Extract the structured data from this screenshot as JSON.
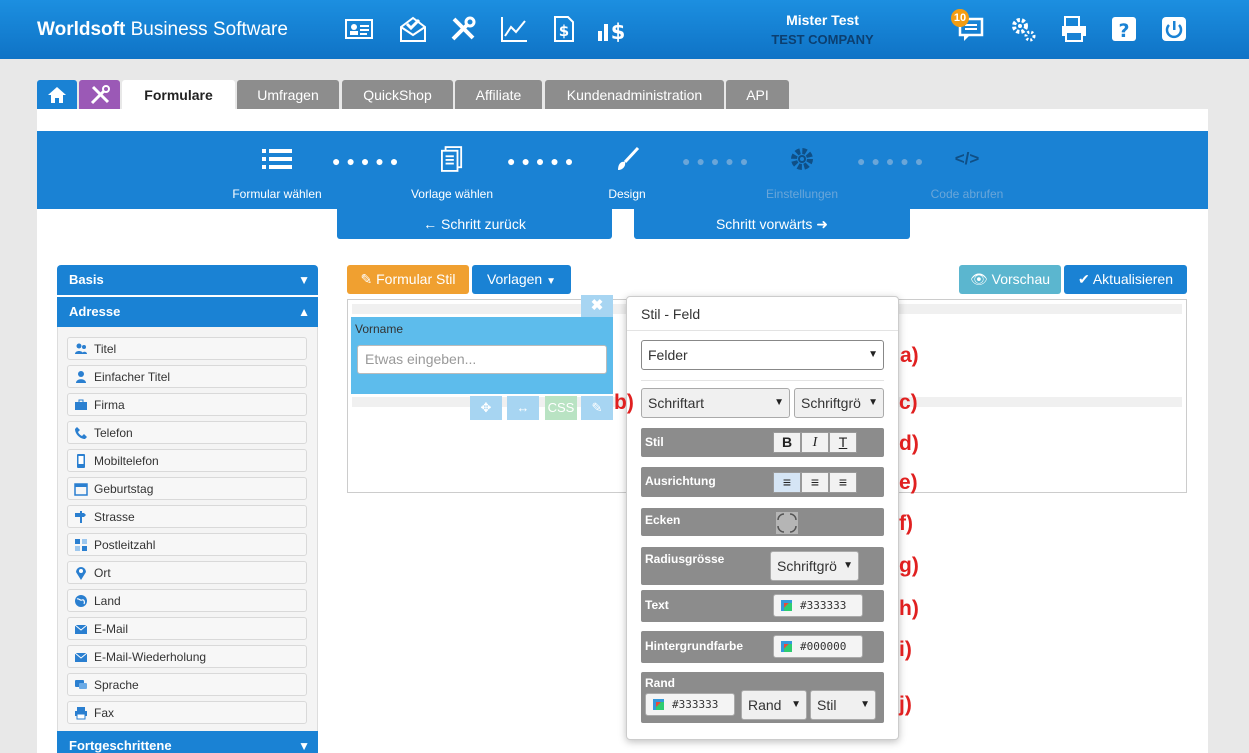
{
  "header": {
    "brand_bold": "Worldsoft",
    "brand_rest": " Business Software",
    "user_name": "Mister Test",
    "company": "TEST COMPANY",
    "notification_count": "10"
  },
  "tabs": [
    {
      "label": "Formulare"
    },
    {
      "label": "Umfragen"
    },
    {
      "label": "QuickShop"
    },
    {
      "label": "Affiliate"
    },
    {
      "label": "Kundenadministration"
    },
    {
      "label": "API"
    }
  ],
  "steps": [
    {
      "label": "Formular wählen"
    },
    {
      "label": "Vorlage wählen"
    },
    {
      "label": "Design"
    },
    {
      "label": "Einstellungen"
    },
    {
      "label": "Code abrufen"
    }
  ],
  "nav": {
    "back": "← Schritt zurück",
    "forward": "Schritt vorwärts ➜"
  },
  "sidebar": {
    "basis": "Basis",
    "adresse": "Adresse",
    "fortgeschrittene": "Fortgeschrittene",
    "items": [
      {
        "label": "Titel"
      },
      {
        "label": "Einfacher Titel"
      },
      {
        "label": "Firma"
      },
      {
        "label": "Telefon"
      },
      {
        "label": "Mobiltelefon"
      },
      {
        "label": "Geburtstag"
      },
      {
        "label": "Strasse"
      },
      {
        "label": "Postleitzahl"
      },
      {
        "label": "Ort"
      },
      {
        "label": "Land"
      },
      {
        "label": "E-Mail"
      },
      {
        "label": "E-Mail-Wiederholung"
      },
      {
        "label": "Sprache"
      },
      {
        "label": "Fax"
      }
    ]
  },
  "toolbar": {
    "formular_stil": "Formular Stil",
    "vorlagen": "Vorlagen",
    "vorschau": "Vorschau",
    "aktualisieren": "Aktualisieren"
  },
  "field": {
    "label": "Vorname",
    "placeholder": "Etwas eingeben...",
    "close": "✖",
    "css": "CSS"
  },
  "popup": {
    "title": "Stil - Feld",
    "felder": "Felder",
    "schriftart": "Schriftart",
    "schriftgroesse": "Schriftgrö",
    "stil": "Stil",
    "ausrichtung": "Ausrichtung",
    "ecken": "Ecken",
    "radiusgroesse": "Radiusgrösse",
    "radius_value": "Schriftgrö",
    "text": "Text",
    "text_color": "#333333",
    "hintergrund": "Hintergrundfarbe",
    "hintergrund_color": "#000000",
    "rand": "Rand",
    "rand_color": "#333333",
    "rand_select": "Rand",
    "stil_select": "Stil",
    "bold": "B",
    "italic": "I",
    "underline": "T"
  },
  "annotations": [
    "a)",
    "b)",
    "c)",
    "d)",
    "e)",
    "f)",
    "g)",
    "h)",
    "i)",
    "j)"
  ]
}
